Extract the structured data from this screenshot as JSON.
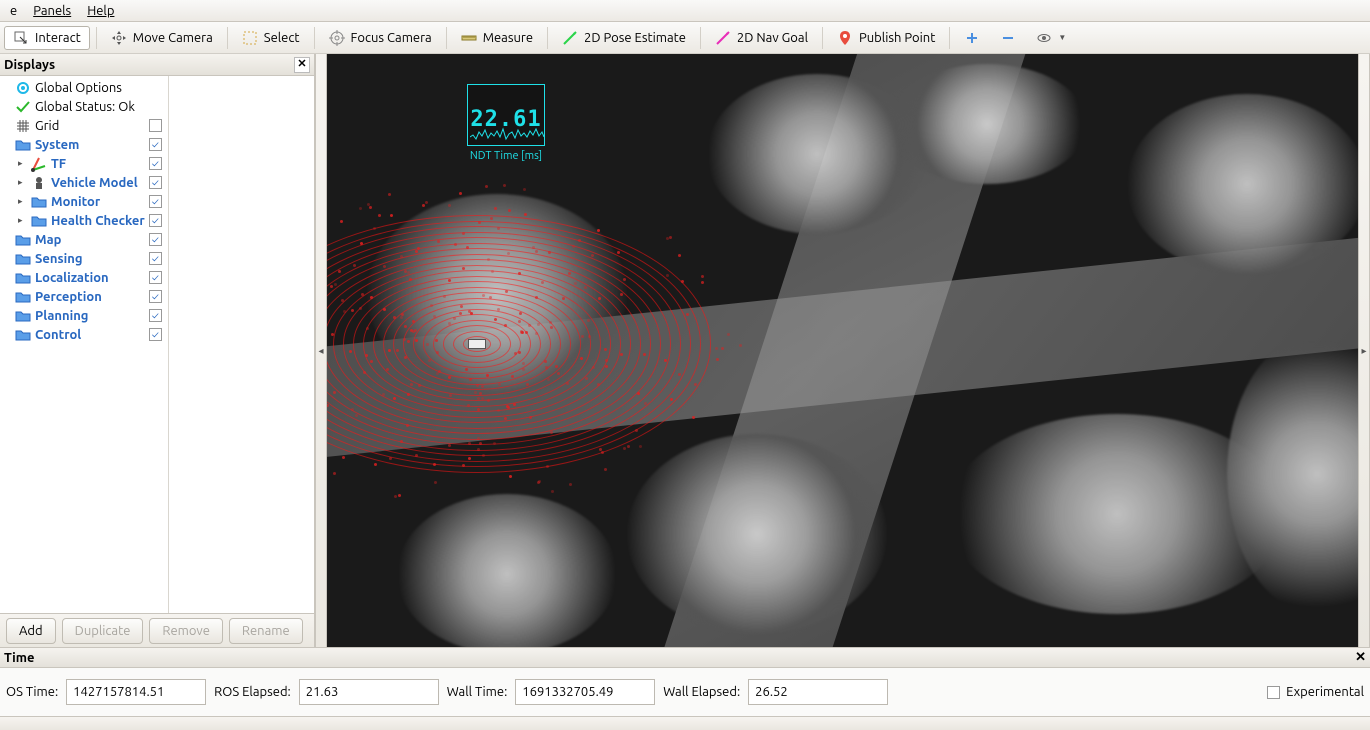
{
  "menubar": {
    "items": [
      "e",
      "Panels",
      "Help"
    ],
    "underline_idx": [
      0,
      0,
      0
    ]
  },
  "toolbar": {
    "interact": "Interact",
    "move_camera": "Move Camera",
    "select": "Select",
    "focus_camera": "Focus Camera",
    "measure": "Measure",
    "pose_estimate": "2D Pose Estimate",
    "nav_goal": "2D Nav Goal",
    "publish_point": "Publish Point"
  },
  "displays": {
    "title": "Displays",
    "items": [
      {
        "icon": "gear-cyan",
        "label": "Global Options",
        "blue": false,
        "checked": null,
        "indent": 0
      },
      {
        "icon": "check-green",
        "label": "Global Status: Ok",
        "blue": false,
        "checked": null,
        "indent": 0
      },
      {
        "icon": "grid",
        "label": "Grid",
        "blue": false,
        "checked": false,
        "indent": 0
      },
      {
        "icon": "folder",
        "label": "System",
        "blue": true,
        "checked": true,
        "indent": 0
      },
      {
        "icon": "tf",
        "label": "TF",
        "blue": true,
        "checked": true,
        "indent": 1,
        "toggle": true
      },
      {
        "icon": "robot",
        "label": "Vehicle Model",
        "blue": true,
        "checked": true,
        "indent": 1,
        "toggle": true
      },
      {
        "icon": "folder",
        "label": "Monitor",
        "blue": true,
        "checked": true,
        "indent": 1,
        "toggle": true
      },
      {
        "icon": "folder",
        "label": "Health Checker",
        "blue": true,
        "checked": true,
        "indent": 1,
        "toggle": true
      },
      {
        "icon": "folder",
        "label": "Map",
        "blue": true,
        "checked": true,
        "indent": 0
      },
      {
        "icon": "folder",
        "label": "Sensing",
        "blue": true,
        "checked": true,
        "indent": 0
      },
      {
        "icon": "folder",
        "label": "Localization",
        "blue": true,
        "checked": true,
        "indent": 0
      },
      {
        "icon": "folder",
        "label": "Perception",
        "blue": true,
        "checked": true,
        "indent": 0
      },
      {
        "icon": "folder",
        "label": "Planning",
        "blue": true,
        "checked": true,
        "indent": 0
      },
      {
        "icon": "folder",
        "label": "Control",
        "blue": true,
        "checked": true,
        "indent": 0
      }
    ],
    "buttons": {
      "add": "Add",
      "duplicate": "Duplicate",
      "remove": "Remove",
      "rename": "Rename"
    }
  },
  "viewport": {
    "ndt_value": "22.61",
    "ndt_label": "NDT Time [ms]"
  },
  "time": {
    "title": "Time",
    "ros_time_label": "OS Time:",
    "ros_time": "1427157814.51",
    "ros_elapsed_label": "ROS Elapsed:",
    "ros_elapsed": "21.63",
    "wall_time_label": "Wall Time:",
    "wall_time": "1691332705.49",
    "wall_elapsed_label": "Wall Elapsed:",
    "wall_elapsed": "26.52",
    "experimental": "Experimental"
  },
  "colors": {
    "accent_blue": "#2968c0",
    "cyan": "#1fe0e8",
    "lidar_red": "#e02020"
  }
}
